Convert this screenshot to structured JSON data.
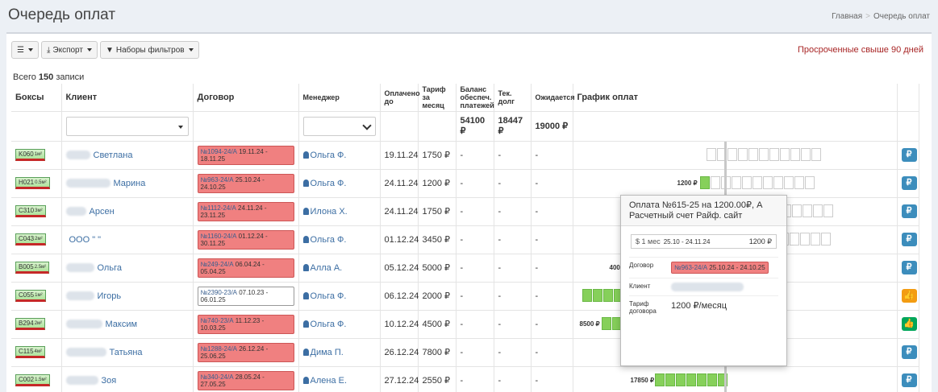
{
  "page": {
    "title": "Очередь оплат",
    "breadcrumb_home": "Главная",
    "breadcrumb_current": "Очередь оплат"
  },
  "toolbar": {
    "list_icon": "list-icon",
    "export": "Экспорт",
    "filters": "Наборы фильтров"
  },
  "overdue": "Просроченные свыше 90 дней",
  "total": {
    "prefix": "Всего",
    "count": "150",
    "suffix": "записи"
  },
  "columns": {
    "boxes": "Боксы",
    "client": "Клиент",
    "contract": "Договор",
    "manager": "Менеджер",
    "paid": "Оплачено до",
    "tariff": "Тариф за месяц",
    "balance": "Баланс обеспеч. платежей",
    "debt": "Тек. долг",
    "expected": "Ожидается",
    "schedule": "График оплат"
  },
  "sums": {
    "balance": "54100 ₽",
    "debt": "18447 ₽",
    "expected": "19000 ₽"
  },
  "rows": [
    {
      "box": "K060",
      "size": "1м²",
      "client": "Светлана",
      "contract": "№1094-24/А",
      "period": "19.11.24 - 18.11.25",
      "manager": "Ольга Ф.",
      "paid": "19.11.24",
      "tariff": "1750 ₽",
      "bal": "-",
      "debt": "-",
      "exp": "-",
      "action": "₽"
    },
    {
      "box": "H021",
      "size": "0.5м²",
      "client": "Марина",
      "contract": "№963-24/А",
      "period": "25.10.24 - 24.10.25",
      "manager": "Ольга Ф.",
      "paid": "24.11.24",
      "tariff": "1200 ₽",
      "bal": "-",
      "debt": "-",
      "exp": "-",
      "sched": "1200 ₽",
      "action": "₽"
    },
    {
      "box": "C310",
      "size": "3м²",
      "client": "Арсен",
      "contract": "№1112-24/А",
      "period": "24.11.24 - 23.11.25",
      "manager": "Илона Х.",
      "paid": "24.11.24",
      "tariff": "1750 ₽",
      "bal": "-",
      "debt": "-",
      "exp": "-",
      "action": "₽"
    },
    {
      "box": "C043",
      "size": "2м²",
      "client": "ООО \"                \"",
      "contract": "№1160-24/А",
      "period": "01.12.24 - 30.11.25",
      "manager": "Ольга Ф.",
      "paid": "01.12.24",
      "tariff": "3450 ₽",
      "bal": "-",
      "debt": "-",
      "exp": "-",
      "action": "₽"
    },
    {
      "box": "B005",
      "size": "2.5м²",
      "client": "Ольга",
      "contract": "№249-24/А",
      "period": "06.04.24 - 05.04.25",
      "manager": "Алла А.",
      "paid": "05.12.24",
      "tariff": "5000 ₽",
      "bal": "-",
      "debt": "-",
      "exp": "-",
      "sched": "400",
      "action": "₽"
    },
    {
      "box": "C055",
      "size": "1м²",
      "client": "Игорь",
      "contract": "№2390-23/А",
      "period": "07.10.23 - 06.01.25",
      "manager": "Ольга Ф.",
      "paid": "06.12.24",
      "tariff": "2000 ₽",
      "bal": "-",
      "debt": "-",
      "exp": "-",
      "action": "👍"
    },
    {
      "box": "B294",
      "size": "2м²",
      "client": "Максим",
      "contract": "№740-23/А",
      "period": "11.12.23 - 10.03.25",
      "manager": "Ольга Ф.",
      "paid": "10.12.24",
      "tariff": "4500 ₽",
      "bal": "-",
      "debt": "-",
      "exp": "-",
      "sched": "8500 ₽",
      "action": "👍"
    },
    {
      "box": "C115",
      "size": "4м²",
      "client": "Татьяна",
      "contract": "№1288-24/А",
      "period": "26.12.24 - 25.06.25",
      "manager": "Дима П.",
      "paid": "26.12.24",
      "tariff": "7800 ₽",
      "bal": "-",
      "debt": "-",
      "exp": "-",
      "action": "₽"
    },
    {
      "box": "C002",
      "size": "1.5м²",
      "client": "Зоя",
      "contract": "№340-24/А",
      "period": "28.05.24 - 27.05.25",
      "manager": "Алена Е.",
      "paid": "27.12.24",
      "tariff": "2550 ₽",
      "bal": "-",
      "debt": "-",
      "exp": "-",
      "sched": "17850 ₽",
      "action": "₽"
    }
  ],
  "popup": {
    "title": "Оплата №615-25 на 1200.00₽, А",
    "title2": "Расчетный счет Райф. сайт",
    "months": "$ 1 мес",
    "period": "25.10 - 24.11.24",
    "amount": "1200 ₽",
    "lbl_contract": "Договор",
    "contract": "№963-24/А",
    "contract_period": "25.10.24 - 24.10.25",
    "lbl_client": "Клиент",
    "lbl_tariff": "Тариф договора",
    "tariff": "1200 ₽/месяц"
  }
}
